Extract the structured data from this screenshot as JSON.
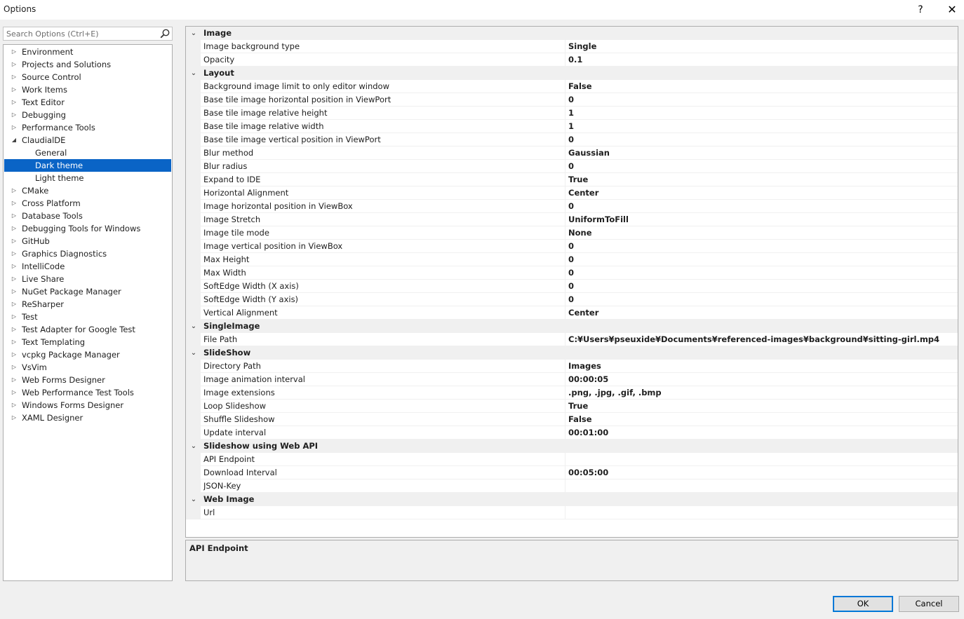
{
  "window": {
    "title": "Options",
    "help_label": "?",
    "close_label": "✕"
  },
  "search": {
    "placeholder": "Search Options (Ctrl+E)",
    "icon": "search-icon"
  },
  "tree": [
    {
      "label": "Environment",
      "expander": "collapsed",
      "level": 0
    },
    {
      "label": "Projects and Solutions",
      "expander": "collapsed",
      "level": 0
    },
    {
      "label": "Source Control",
      "expander": "collapsed",
      "level": 0
    },
    {
      "label": "Work Items",
      "expander": "collapsed",
      "level": 0
    },
    {
      "label": "Text Editor",
      "expander": "collapsed",
      "level": 0
    },
    {
      "label": "Debugging",
      "expander": "collapsed",
      "level": 0
    },
    {
      "label": "Performance Tools",
      "expander": "collapsed",
      "level": 0
    },
    {
      "label": "ClaudialDE",
      "expander": "expanded",
      "level": 0
    },
    {
      "label": "General",
      "expander": "none",
      "level": 1
    },
    {
      "label": "Dark theme",
      "expander": "none",
      "level": 1,
      "selected": true
    },
    {
      "label": "Light theme",
      "expander": "none",
      "level": 1
    },
    {
      "label": "CMake",
      "expander": "collapsed",
      "level": 0
    },
    {
      "label": "Cross Platform",
      "expander": "collapsed",
      "level": 0
    },
    {
      "label": "Database Tools",
      "expander": "collapsed",
      "level": 0
    },
    {
      "label": "Debugging Tools for Windows",
      "expander": "collapsed",
      "level": 0
    },
    {
      "label": "GitHub",
      "expander": "collapsed",
      "level": 0
    },
    {
      "label": "Graphics Diagnostics",
      "expander": "collapsed",
      "level": 0
    },
    {
      "label": "IntelliCode",
      "expander": "collapsed",
      "level": 0
    },
    {
      "label": "Live Share",
      "expander": "collapsed",
      "level": 0
    },
    {
      "label": "NuGet Package Manager",
      "expander": "collapsed",
      "level": 0
    },
    {
      "label": "ReSharper",
      "expander": "collapsed",
      "level": 0
    },
    {
      "label": "Test",
      "expander": "collapsed",
      "level": 0
    },
    {
      "label": "Test Adapter for Google Test",
      "expander": "collapsed",
      "level": 0
    },
    {
      "label": "Text Templating",
      "expander": "collapsed",
      "level": 0
    },
    {
      "label": "vcpkg Package Manager",
      "expander": "collapsed",
      "level": 0
    },
    {
      "label": "VsVim",
      "expander": "collapsed",
      "level": 0
    },
    {
      "label": "Web Forms Designer",
      "expander": "collapsed",
      "level": 0
    },
    {
      "label": "Web Performance Test Tools",
      "expander": "collapsed",
      "level": 0
    },
    {
      "label": "Windows Forms Designer",
      "expander": "collapsed",
      "level": 0
    },
    {
      "label": "XAML Designer",
      "expander": "collapsed",
      "level": 0
    }
  ],
  "grid": [
    {
      "type": "category",
      "label": "Image"
    },
    {
      "type": "property",
      "name": "Image background type",
      "value": "Single"
    },
    {
      "type": "property",
      "name": "Opacity",
      "value": "0.1"
    },
    {
      "type": "category",
      "label": "Layout"
    },
    {
      "type": "property",
      "name": "Background image limit to only editor window",
      "value": "False"
    },
    {
      "type": "property",
      "name": "Base tile image horizontal position in ViewPort",
      "value": "0"
    },
    {
      "type": "property",
      "name": "Base tile image relative height",
      "value": "1"
    },
    {
      "type": "property",
      "name": "Base tile image relative width",
      "value": "1"
    },
    {
      "type": "property",
      "name": "Base tile image vertical position in ViewPort",
      "value": "0"
    },
    {
      "type": "property",
      "name": "Blur method",
      "value": "Gaussian"
    },
    {
      "type": "property",
      "name": "Blur radius",
      "value": "0"
    },
    {
      "type": "property",
      "name": "Expand to IDE",
      "value": "True"
    },
    {
      "type": "property",
      "name": "Horizontal Alignment",
      "value": "Center"
    },
    {
      "type": "property",
      "name": "Image horizontal position in ViewBox",
      "value": "0"
    },
    {
      "type": "property",
      "name": "Image Stretch",
      "value": "UniformToFill"
    },
    {
      "type": "property",
      "name": "Image tile mode",
      "value": "None"
    },
    {
      "type": "property",
      "name": "Image vertical position in ViewBox",
      "value": "0"
    },
    {
      "type": "property",
      "name": "Max Height",
      "value": "0"
    },
    {
      "type": "property",
      "name": "Max Width",
      "value": "0"
    },
    {
      "type": "property",
      "name": "SoftEdge Width (X axis)",
      "value": "0"
    },
    {
      "type": "property",
      "name": "SoftEdge Width (Y axis)",
      "value": "0"
    },
    {
      "type": "property",
      "name": "Vertical Alignment",
      "value": "Center"
    },
    {
      "type": "category",
      "label": "SingleImage"
    },
    {
      "type": "property",
      "name": "File Path",
      "value": "C:¥Users¥pseuxide¥Documents¥referenced-images¥background¥sitting-girl.mp4"
    },
    {
      "type": "category",
      "label": "SlideShow"
    },
    {
      "type": "property",
      "name": "Directory Path",
      "value": "Images"
    },
    {
      "type": "property",
      "name": "Image animation interval",
      "value": "00:00:05"
    },
    {
      "type": "property",
      "name": "Image extensions",
      "value": ".png, .jpg, .gif, .bmp"
    },
    {
      "type": "property",
      "name": "Loop Slideshow",
      "value": "True"
    },
    {
      "type": "property",
      "name": "Shuffle Slideshow",
      "value": "False"
    },
    {
      "type": "property",
      "name": "Update interval",
      "value": "00:01:00"
    },
    {
      "type": "category",
      "label": "Slideshow using Web API"
    },
    {
      "type": "property",
      "name": "API Endpoint",
      "value": ""
    },
    {
      "type": "property",
      "name": "Download Interval",
      "value": "00:05:00"
    },
    {
      "type": "property",
      "name": "JSON-Key",
      "value": ""
    },
    {
      "type": "category",
      "label": "Web Image"
    },
    {
      "type": "property",
      "name": "Url",
      "value": ""
    }
  ],
  "description": {
    "title": "API Endpoint"
  },
  "buttons": {
    "ok": "OK",
    "cancel": "Cancel"
  },
  "colors": {
    "selection": "#0a64c6",
    "ok_border": "#0078d7",
    "panel_bg": "#f0f0f0"
  }
}
